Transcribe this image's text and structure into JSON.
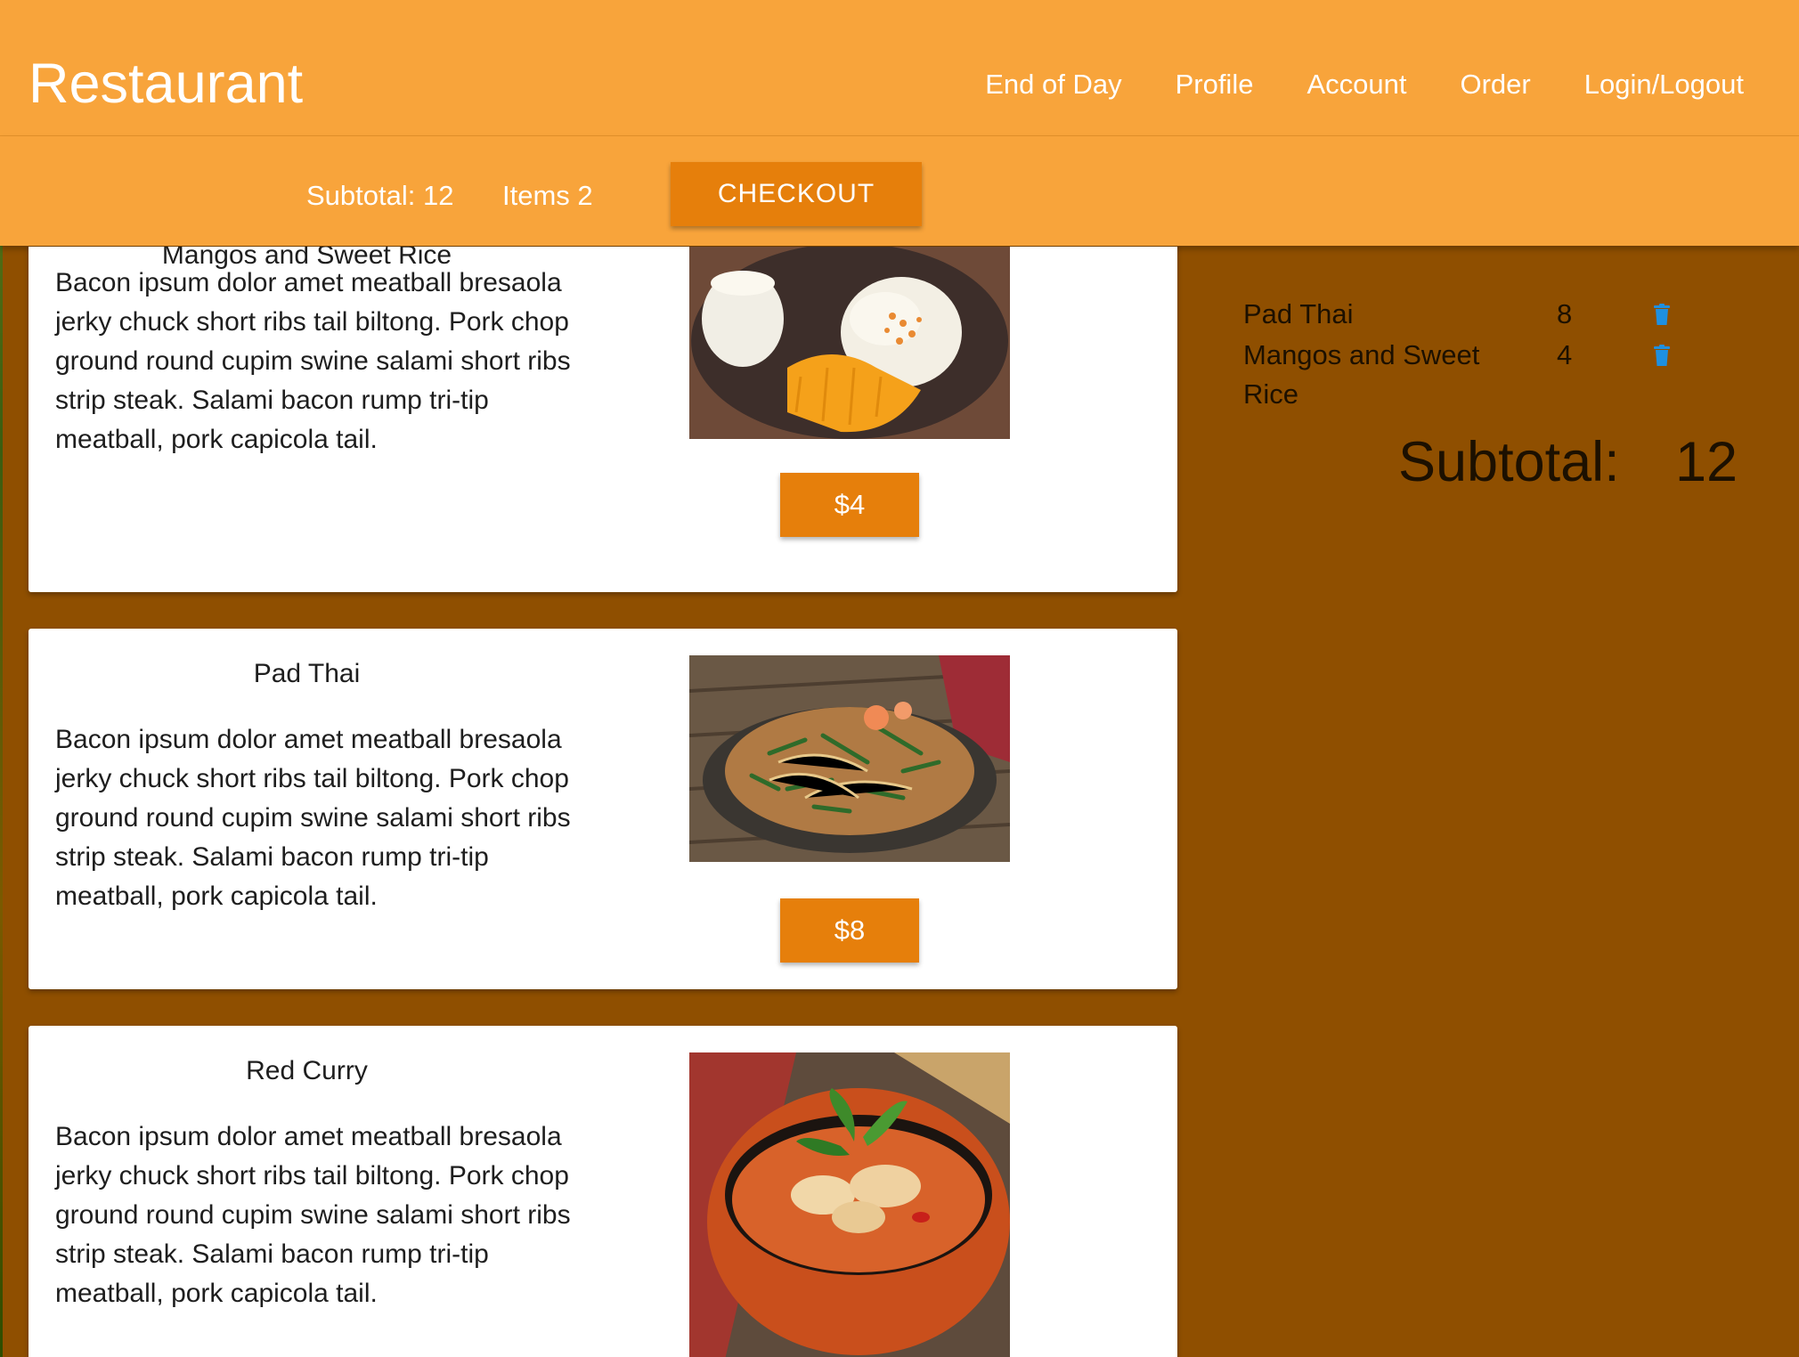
{
  "navbar": {
    "brand": "Restaurant",
    "links": [
      "End of Day",
      "Profile",
      "Account",
      "Order",
      "Login/Logout"
    ]
  },
  "summary_bar": {
    "subtotal_text": "Subtotal: 12",
    "items_text": "Items 2",
    "checkout_label": "CHECKOUT"
  },
  "menu": {
    "items": [
      {
        "name": "Mangos and Sweet Rice",
        "description": "Bacon ipsum dolor amet meatball bresaola jerky chuck short ribs tail biltong. Pork chop ground round cupim swine salami short ribs strip steak. Salami bacon rump tri-tip meatball, pork capicola tail.",
        "price_label": "$4"
      },
      {
        "name": "Pad Thai",
        "description": "Bacon ipsum dolor amet meatball bresaola jerky chuck short ribs tail biltong. Pork chop ground round cupim swine salami short ribs strip steak. Salami bacon rump tri-tip meatball, pork capicola tail.",
        "price_label": "$8"
      },
      {
        "name": "Red Curry",
        "description": "Bacon ipsum dolor amet meatball bresaola jerky chuck short ribs tail biltong. Pork chop ground round cupim swine salami short ribs strip steak. Salami bacon rump tri-tip meatball, pork capicola tail.",
        "price_label": ""
      }
    ]
  },
  "cart": {
    "items": [
      {
        "name": "Pad Thai",
        "price": "8",
        "icon": "trash-icon"
      },
      {
        "name": "Mangos and Sweet Rice",
        "price": "4",
        "icon": "trash-icon"
      }
    ],
    "subtotal_label": "Subtotal:",
    "subtotal_value": "12"
  },
  "colors": {
    "header": "#f8a43b",
    "accent_button": "#e67f0b",
    "background": "#8f4f00",
    "card": "#ffffff",
    "trash_icon": "#1e90e0"
  }
}
